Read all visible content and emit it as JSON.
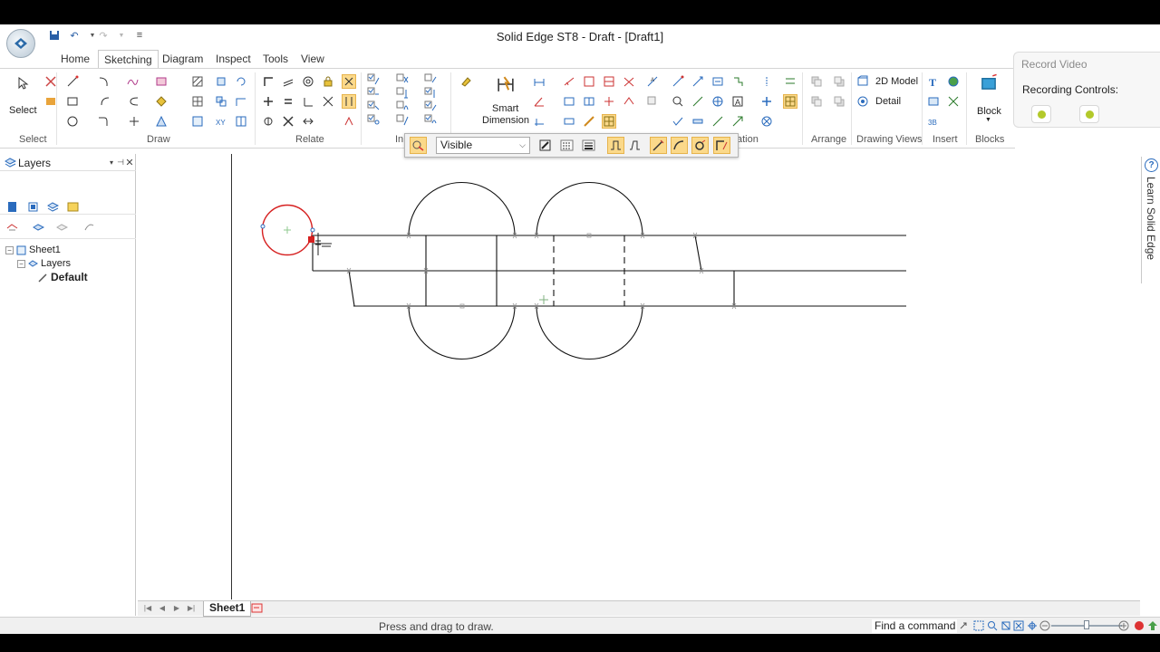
{
  "window": {
    "title": "Solid Edge ST8 - Draft - [Draft1]"
  },
  "tabs": [
    {
      "label": "Home"
    },
    {
      "label": "Sketching",
      "active": true
    },
    {
      "label": "Diagram"
    },
    {
      "label": "Inspect"
    },
    {
      "label": "Tools"
    },
    {
      "label": "View"
    }
  ],
  "ribbon": {
    "groups": {
      "select": "Select",
      "draw": "Draw",
      "relate": "Relate",
      "intellisketch": "In",
      "annotation": "ation",
      "arrange": "Arrange",
      "drawing_views": "Drawing Views",
      "insert": "Insert",
      "blocks": "Blocks"
    },
    "select_label": "Select",
    "smart_dimension_label_1": "Smart",
    "smart_dimension_label_2": "Dimension",
    "model_2d_label": "2D Model",
    "detail_label": "Detail",
    "block_label": "Block"
  },
  "line_toolbar": {
    "line_type": "Visible"
  },
  "record_panel": {
    "title": "Record Video",
    "controls_label": "Recording Controls:"
  },
  "layers_pane": {
    "title": "Layers",
    "tree": {
      "sheet": "Sheet1",
      "layers": "Layers",
      "default_layer": "Default"
    }
  },
  "learn_tab": {
    "label": "Learn Solid Edge",
    "help": "?"
  },
  "sheets": [
    {
      "name": "Sheet1",
      "active": true
    }
  ],
  "status": {
    "prompt": "Press and drag to draw.",
    "find_command": "Find a command"
  },
  "colors": {
    "highlight": "#fbd98a",
    "selection_red": "#d62020",
    "drawing_black": "#111111",
    "construction_green": "#8fc98f",
    "record_green": "#b3c92a",
    "accent_blue": "#2a6bbd"
  }
}
